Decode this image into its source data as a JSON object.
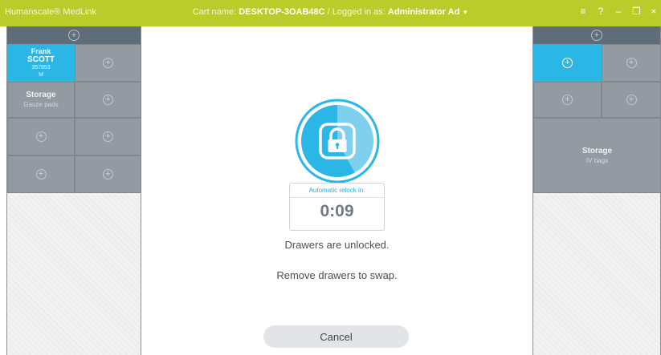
{
  "titlebar": {
    "brand": "Humanscale® MedLink",
    "cart_label": "Cart name:",
    "cart_name": "DESKTOP-3OAB48C",
    "separator": "/",
    "logged_label": "Logged in as:",
    "user": "Administrator Ad",
    "controls": {
      "menu": "≡",
      "help": "?",
      "minimize": "–",
      "restore": "❐",
      "close": "×"
    }
  },
  "left_panel": {
    "header_icon": "plus-circle-icon",
    "patient": {
      "first": "Frank",
      "last": "SCOTT",
      "id": "357853",
      "sex": "M"
    },
    "storage": {
      "title": "Storage",
      "subtitle": "Gauze pads"
    }
  },
  "right_panel": {
    "header_icon": "plus-circle-icon",
    "storage": {
      "title": "Storage",
      "subtitle": "IV bags"
    }
  },
  "center": {
    "lock_icon": "padlock-icon",
    "relock_label": "Automatic relock in:",
    "countdown": "0:09",
    "countdown_progress": 0.58,
    "message1": "Drawers are unlocked.",
    "message2": "Remove drawers to swap.",
    "cancel_label": "Cancel"
  },
  "colors": {
    "accent": "#2ab7e6",
    "titlebar": "#b9cc2a",
    "drawer": "#939aa2",
    "panel_header": "#5f6d7b"
  }
}
